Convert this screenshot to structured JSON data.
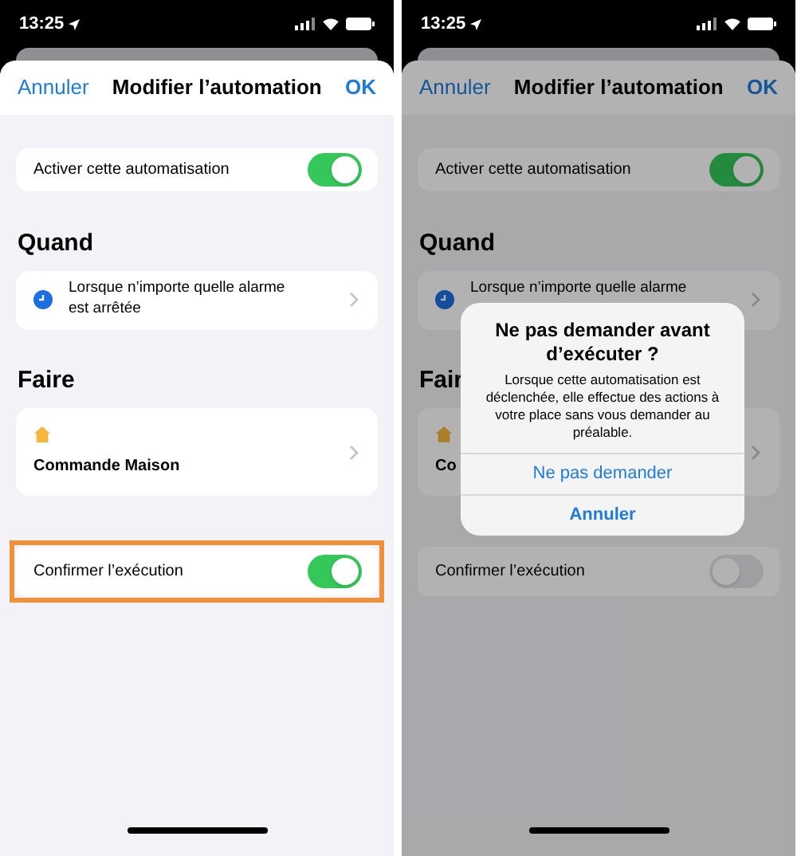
{
  "screens": [
    {
      "status_time": "13:25",
      "dimmed": false,
      "nav": {
        "cancel": "Annuler",
        "title": "Modifier l’automation",
        "ok": "OK"
      },
      "enable_row": {
        "label": "Activer cette automatisation",
        "on": true
      },
      "when": {
        "heading": "Quand",
        "trigger_text": "Lorsque n’importe quelle alarme est arrêtée"
      },
      "do": {
        "heading": "Faire",
        "action_label": "Commande Maison"
      },
      "confirm_row": {
        "label": "Confirmer l’exécution",
        "on": true,
        "highlighted": true
      }
    },
    {
      "status_time": "13:25",
      "dimmed": true,
      "nav": {
        "cancel": "Annuler",
        "title": "Modifier l’automation",
        "ok": "OK"
      },
      "enable_row": {
        "label": "Activer cette automatisation",
        "on": true
      },
      "when": {
        "heading": "Quand",
        "trigger_text": "Lorsque n’importe quelle alarme"
      },
      "do": {
        "heading": "Fair",
        "action_label": "Co"
      },
      "confirm_row": {
        "label": "Confirmer l’exécution",
        "on": false,
        "highlighted": false
      },
      "alert": {
        "title": "Ne pas demander avant d’exécuter ?",
        "message": "Lorsque cette automatisation est déclenchée, elle effectue des actions à votre place sans vous demander au préalable.",
        "actions": [
          {
            "label": "Ne pas demander",
            "kind": "default"
          },
          {
            "label": "Annuler",
            "kind": "cancel"
          }
        ]
      }
    }
  ]
}
